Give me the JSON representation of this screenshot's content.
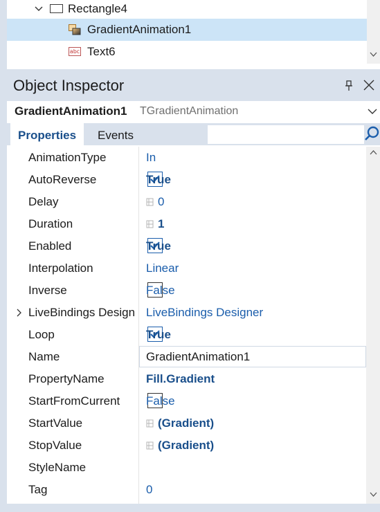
{
  "tree": {
    "items": [
      {
        "label": "Rectangle4",
        "icon": "rectangle-icon"
      },
      {
        "label": "GradientAnimation1",
        "icon": "gradient-animation-icon",
        "selected": true
      },
      {
        "label": "Text6",
        "icon": "text-icon"
      }
    ],
    "text_icon_glyph": "abc"
  },
  "inspector": {
    "title": "Object Inspector",
    "object_name": "GradientAnimation1",
    "object_type": "TGradientAnimation",
    "tabs": [
      "Properties",
      "Events"
    ],
    "search": {
      "placeholder": "",
      "value": ""
    }
  },
  "properties": [
    {
      "name": "AnimationType",
      "value": "In"
    },
    {
      "name": "AutoReverse",
      "value": "True",
      "checkbox": true,
      "checked": true
    },
    {
      "name": "Delay",
      "value": "0",
      "icon": "spin-icon"
    },
    {
      "name": "Duration",
      "value": "1",
      "icon": "spin-icon",
      "bold": true
    },
    {
      "name": "Enabled",
      "value": "True",
      "checkbox": true,
      "checked": true
    },
    {
      "name": "Interpolation",
      "value": "Linear"
    },
    {
      "name": "Inverse",
      "value": "False",
      "checkbox": true,
      "checked": false
    },
    {
      "name": "LiveBindings Design",
      "value": "LiveBindings Designer",
      "expandable": true
    },
    {
      "name": "Loop",
      "value": "True",
      "checkbox": true,
      "checked": true
    },
    {
      "name": "Name",
      "value": "GradientAnimation1",
      "editing": true
    },
    {
      "name": "PropertyName",
      "value": "Fill.Gradient",
      "bold": true
    },
    {
      "name": "StartFromCurrent",
      "value": "False",
      "checkbox": true,
      "checked": false
    },
    {
      "name": "StartValue",
      "value": "(Gradient)",
      "icon": "spin-icon",
      "bold": true
    },
    {
      "name": "StopValue",
      "value": "(Gradient)",
      "icon": "spin-icon",
      "bold": true
    },
    {
      "name": "StyleName",
      "value": ""
    },
    {
      "name": "Tag",
      "value": "0"
    }
  ],
  "colors": {
    "accent": "#1a5dab",
    "selection": "#cce4f7",
    "panel": "#d9e1ec"
  }
}
